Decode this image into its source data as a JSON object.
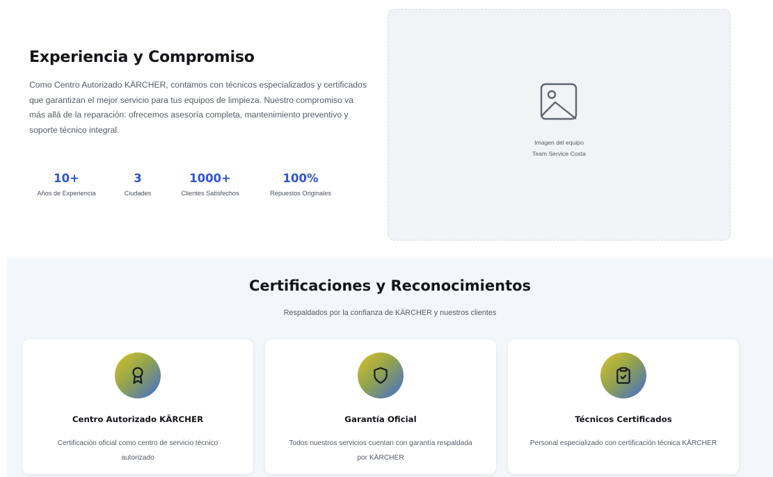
{
  "experience": {
    "title": "Experiencia y Compromiso",
    "paragraph": "Como Centro Autorizado KÄRCHER, contamos con técnicos especializados y certificados que garantizan el mejor servicio para tus equipos de limpieza. Nuestro compromiso va más allá de la reparación: ofrecemos asesoría completa, mantenimiento preventivo y soporte técnico integral.",
    "stats": [
      {
        "value": "10+",
        "label": "Años de Experiencia"
      },
      {
        "value": "3",
        "label": "Ciudades"
      },
      {
        "value": "1000+",
        "label": "Clientes Satisfechos"
      },
      {
        "value": "100%",
        "label": "Repuestos Originales"
      }
    ],
    "image": {
      "icon": "image-icon",
      "caption_line1": "Imagen del equipo",
      "caption_line2": "Team Service Costa"
    }
  },
  "certifications": {
    "title": "Certificaciones y Reconocimientos",
    "subtitle": "Respaldados por la confianza de KÄRCHER y nuestros clientes",
    "badge_gradient": [
      "#d8c22a",
      "#3f6bd2"
    ],
    "cards": [
      {
        "icon": "award-icon",
        "title": "Centro Autorizado KÄRCHER",
        "description": "Certificación oficial como centro de servicio técnico autorizado"
      },
      {
        "icon": "shield-icon",
        "title": "Garantía Oficial",
        "description": "Todos nuestros servicios cuentan con garantía respaldada por KÄRCHER"
      },
      {
        "icon": "clipboard-check-icon",
        "title": "Técnicos Certificados",
        "description": "Personal especializado con certificación técnica KÄRCHER"
      }
    ]
  },
  "colors": {
    "accent": "#2f55d4",
    "heading": "#14151a",
    "body_text": "#555b66",
    "section_bg": "#f3f6fa"
  }
}
